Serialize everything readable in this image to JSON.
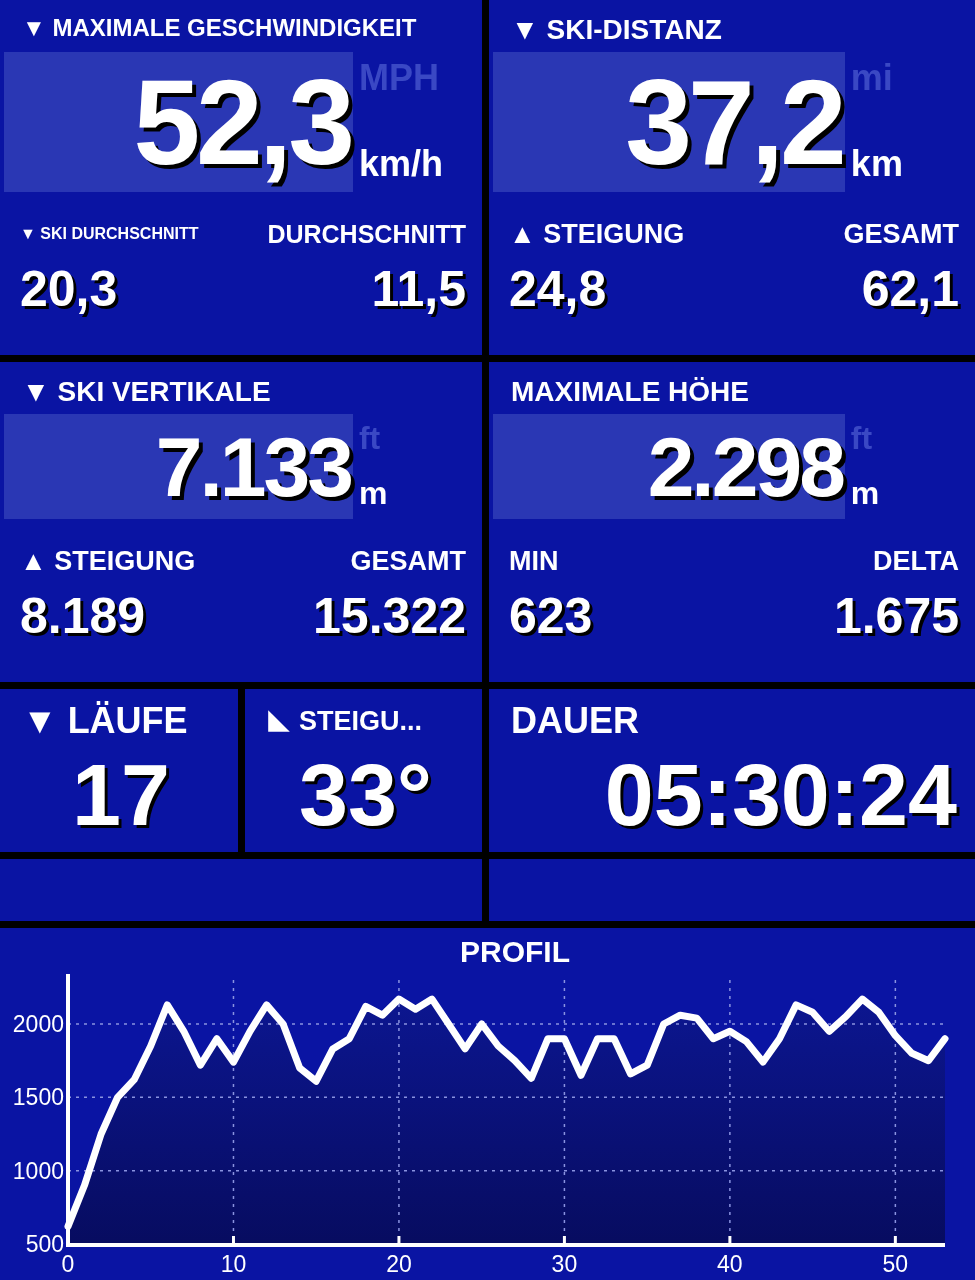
{
  "stat_tiles": [
    {
      "title": "▼ MAXIMALE GESCHWINDIGKEIT",
      "value": "52,3",
      "units": [
        {
          "label": "MPH",
          "selected": false
        },
        {
          "label": "km/h",
          "selected": true
        }
      ],
      "sub_stats": [
        {
          "label": "▼ SKI DURCHSCHNITT",
          "value": "20,3"
        },
        {
          "label": "DURCHSCHNITT",
          "value": "11,5"
        }
      ]
    },
    {
      "title": "▼ SKI-DISTANZ",
      "value": "37,2",
      "units": [
        {
          "label": "mi",
          "selected": false
        },
        {
          "label": "km",
          "selected": true
        }
      ],
      "sub_stats": [
        {
          "label": "▲ STEIGUNG",
          "value": "24,8"
        },
        {
          "label": "GESAMT",
          "value": "62,1"
        }
      ]
    },
    {
      "title": "▼ SKI VERTIKALE",
      "value": "7.133",
      "units": [
        {
          "label": "ft",
          "selected": false
        },
        {
          "label": "m",
          "selected": true
        }
      ],
      "sub_stats": [
        {
          "label": "▲ STEIGUNG",
          "value": "8.189"
        },
        {
          "label": "GESAMT",
          "value": "15.322"
        }
      ]
    },
    {
      "title": "MAXIMALE HÖHE",
      "value": "2.298",
      "units": [
        {
          "label": "ft",
          "selected": false
        },
        {
          "label": "m",
          "selected": true
        }
      ],
      "sub_stats": [
        {
          "label": "MIN",
          "value": "623"
        },
        {
          "label": "DELTA",
          "value": "1.675"
        }
      ]
    }
  ],
  "small_tiles": [
    {
      "kind": "plain",
      "title": "▼ LÄUFE",
      "value": "17"
    },
    {
      "kind": "slope",
      "title": "STEIGU...",
      "value": "33°"
    },
    {
      "kind": "plain",
      "title": "DAUER",
      "value": "05:30:24"
    }
  ],
  "profile": {
    "title": "PROFIL",
    "chart_data": {
      "type": "area",
      "x": [
        0,
        1,
        2,
        3,
        4,
        5,
        6,
        7,
        8,
        9,
        10,
        11,
        12,
        13,
        14,
        15,
        16,
        17,
        18,
        19,
        20,
        21,
        22,
        23,
        24,
        25,
        26,
        27,
        28,
        29,
        30,
        31,
        32,
        33,
        34,
        35,
        36,
        37,
        38,
        39,
        40,
        41,
        42,
        43,
        44,
        45,
        46,
        47,
        48,
        49,
        50,
        51,
        52,
        53
      ],
      "series": [
        {
          "color": "#ffffff",
          "values": [
            620,
            900,
            1250,
            1500,
            1620,
            1850,
            2130,
            1950,
            1720,
            1900,
            1740,
            1950,
            2130,
            2000,
            1700,
            1610,
            1830,
            1900,
            2120,
            2060,
            2170,
            2100,
            2170,
            2000,
            1830,
            2000,
            1850,
            1750,
            1630,
            1900,
            1900,
            1650,
            1900,
            1900,
            1660,
            1720,
            2000,
            2060,
            2040,
            1900,
            1950,
            1880,
            1740,
            1900,
            2130,
            2080,
            1950,
            2050,
            2170,
            2080,
            1920,
            1800,
            1750,
            1900
          ]
        }
      ],
      "grid": true,
      "xlim": [
        0,
        53
      ],
      "ylim": [
        500,
        2300
      ],
      "xticks": [
        0,
        10,
        20,
        30,
        40,
        50
      ],
      "yticks": [
        500,
        1000,
        1500,
        2000
      ]
    }
  }
}
